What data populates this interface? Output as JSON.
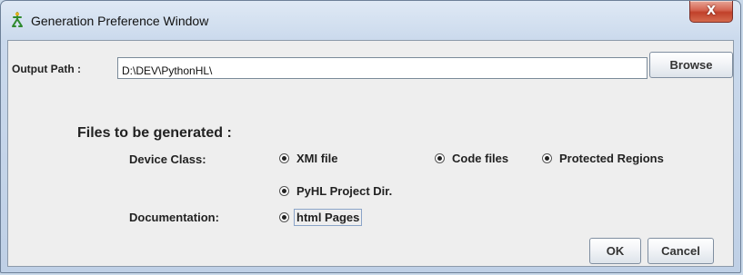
{
  "window": {
    "title": "Generation Preference  Window",
    "close_symbol": "X"
  },
  "output": {
    "label": "Output Path :",
    "value": "D:\\DEV\\PythonHL\\",
    "browse_label": "Browse"
  },
  "files_heading": "Files to be generated :",
  "device_class": {
    "label": "Device Class:",
    "options": [
      {
        "label": "XMI  file",
        "selected": true
      },
      {
        "label": "Code files",
        "selected": true
      },
      {
        "label": "Protected Regions",
        "selected": true
      },
      {
        "label": "PyHL Project Dir.",
        "selected": true
      }
    ]
  },
  "documentation": {
    "label": "Documentation:",
    "options": [
      {
        "label": "html Pages",
        "selected": true
      }
    ]
  },
  "buttons": {
    "ok": "OK",
    "cancel": "Cancel"
  },
  "icons": {
    "app": "app-figure-icon",
    "close": "close-icon",
    "radio": "radio-icon"
  }
}
